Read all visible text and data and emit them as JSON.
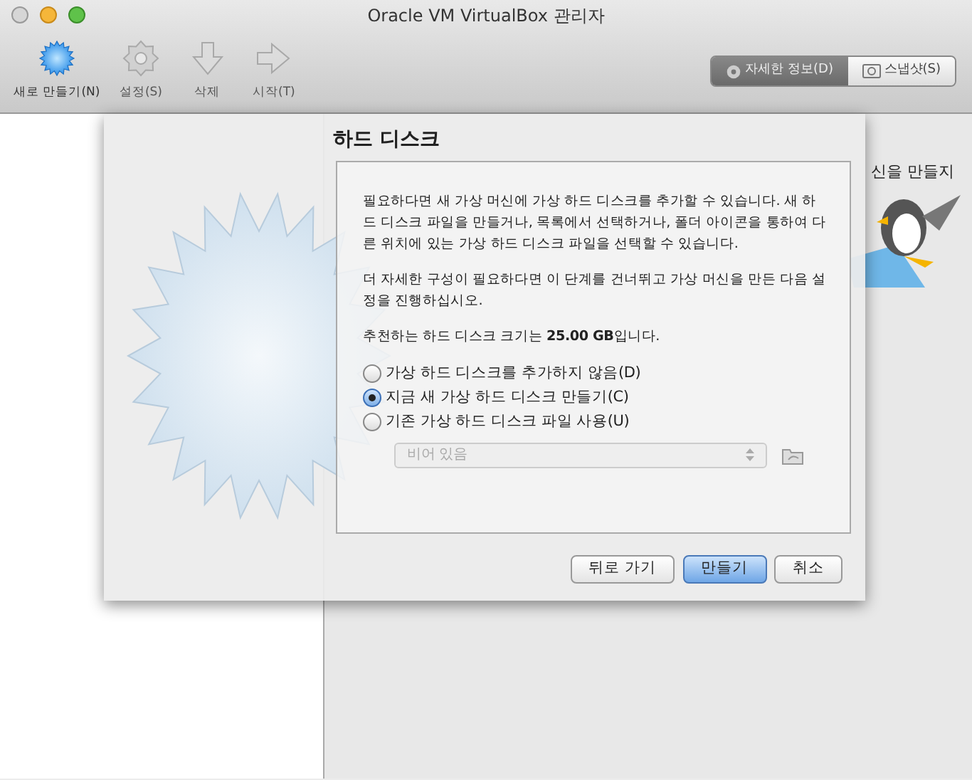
{
  "window": {
    "title": "Oracle VM VirtualBox 관리자"
  },
  "toolbar": [
    {
      "kind": "new",
      "label": "새로 만들기(N)",
      "disabled": false
    },
    {
      "kind": "settings",
      "label": "설정(S)",
      "disabled": true
    },
    {
      "kind": "delete",
      "label": "삭제",
      "disabled": true
    },
    {
      "kind": "start",
      "label": "시작(T)",
      "disabled": true
    }
  ],
  "view_switch": [
    {
      "kind": "details",
      "label": "자세한 정보(D)",
      "selected": true
    },
    {
      "kind": "snapshots",
      "label": "스냅샷(S)",
      "selected": false
    }
  ],
  "background_text": "신을 만들지",
  "dialog": {
    "title": "하드 디스크",
    "paragraphs": [
      "필요하다면 새 가상 머신에 가상 하드 디스크를 추가할 수 있습니다. 새 하드 디스크 파일을 만들거나, 목록에서 선택하거나, 폴더 아이콘을 통하여 다른 위치에 있는 가상 하드 디스크 파일을 선택할 수 있습니다.",
      "더 자세한 구성이 필요하다면 이 단계를 건너뛰고 가상 머신을 만든 다음 설정을 진행하십시오.",
      "추천하는 하드 디스크 크기는 **25.00 GB**입니다."
    ],
    "options": [
      {
        "label": "가상 하드 디스크를 추가하지 않음(D)",
        "selected": false
      },
      {
        "label": "지금 새 가상 하드 디스크 만들기(C)",
        "selected": true
      },
      {
        "label": "기존 가상 하드 디스크 파일 사용(U)",
        "selected": false
      }
    ],
    "combo": {
      "value": "비어 있음",
      "disabled": true
    },
    "buttons": [
      {
        "label": "뒤로 가기",
        "default": false
      },
      {
        "label": "만들기",
        "default": true
      },
      {
        "label": "취소",
        "default": false
      }
    ]
  }
}
